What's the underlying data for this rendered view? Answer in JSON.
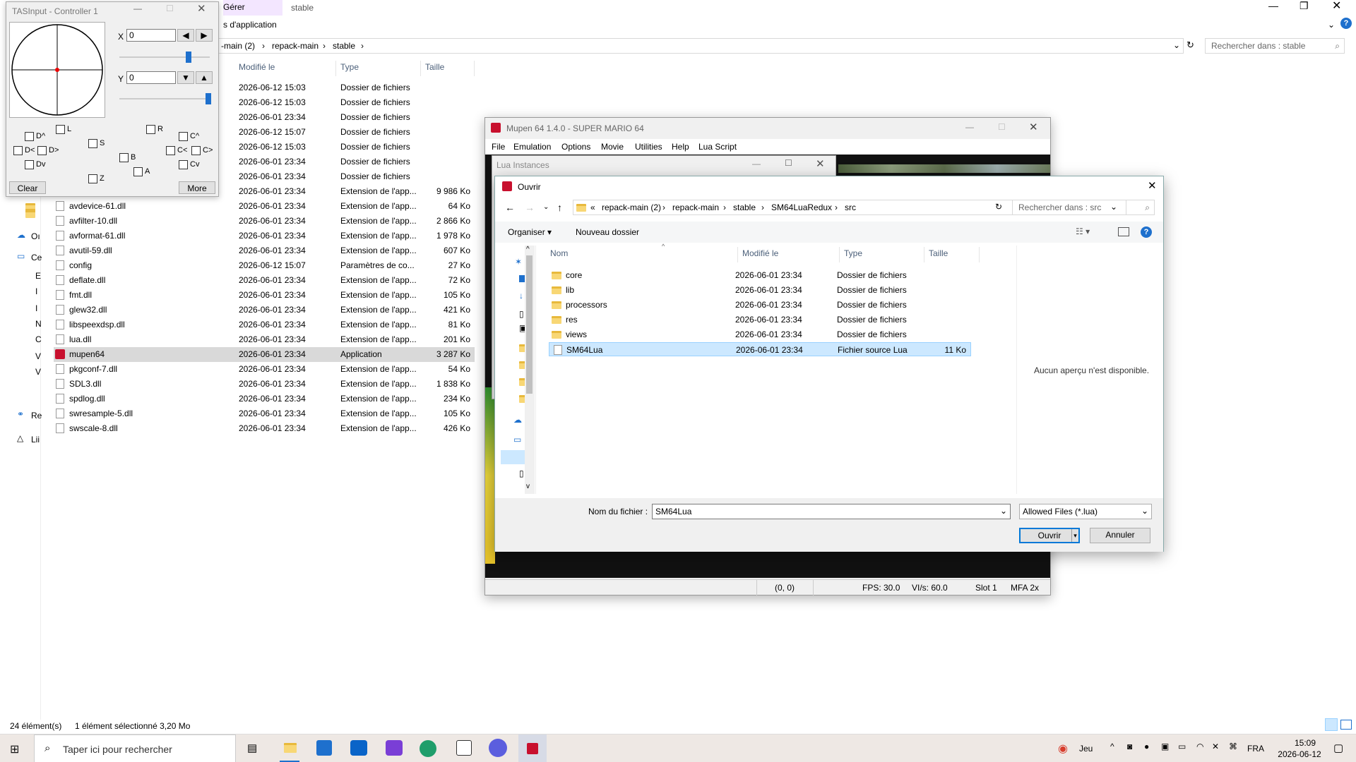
{
  "explorer": {
    "ribbon_tab": "Gérer",
    "ribbon_subtab": "s d'application",
    "window_title": "stable",
    "breadcrumb": [
      "-main (2)",
      "repack-main",
      "stable"
    ],
    "search_placeholder": "Rechercher dans : stable",
    "columns": {
      "modified": "Modifié le",
      "type": "Type",
      "size": "Taille"
    },
    "folder_rows": [
      {
        "date": "2026-06-12 15:03",
        "type": "Dossier de fichiers"
      },
      {
        "date": "2026-06-12 15:03",
        "type": "Dossier de fichiers"
      },
      {
        "date": "2026-06-01 23:34",
        "type": "Dossier de fichiers"
      },
      {
        "date": "2026-06-12 15:07",
        "type": "Dossier de fichiers"
      },
      {
        "date": "2026-06-12 15:03",
        "type": "Dossier de fichiers"
      },
      {
        "date": "2026-06-01 23:34",
        "type": "Dossier de fichiers"
      },
      {
        "date": "2026-06-01 23:34",
        "type": "Dossier de fichiers"
      },
      {
        "date": "2026-06-01 23:34",
        "type": "Extension de l'app...",
        "size": "9 986 Ko"
      }
    ],
    "files": [
      {
        "name": "avdevice-61.dll",
        "date": "2026-06-01 23:34",
        "type": "Extension de l'app...",
        "size": "64 Ko"
      },
      {
        "name": "avfilter-10.dll",
        "date": "2026-06-01 23:34",
        "type": "Extension de l'app...",
        "size": "2 866 Ko"
      },
      {
        "name": "avformat-61.dll",
        "date": "2026-06-01 23:34",
        "type": "Extension de l'app...",
        "size": "1 978 Ko"
      },
      {
        "name": "avutil-59.dll",
        "date": "2026-06-01 23:34",
        "type": "Extension de l'app...",
        "size": "607 Ko"
      },
      {
        "name": "config",
        "date": "2026-06-12 15:07",
        "type": "Paramètres de co...",
        "size": "27 Ko"
      },
      {
        "name": "deflate.dll",
        "date": "2026-06-01 23:34",
        "type": "Extension de l'app...",
        "size": "72 Ko"
      },
      {
        "name": "fmt.dll",
        "date": "2026-06-01 23:34",
        "type": "Extension de l'app...",
        "size": "105 Ko"
      },
      {
        "name": "glew32.dll",
        "date": "2026-06-01 23:34",
        "type": "Extension de l'app...",
        "size": "421 Ko"
      },
      {
        "name": "libspeexdsp.dll",
        "date": "2026-06-01 23:34",
        "type": "Extension de l'app...",
        "size": "81 Ko"
      },
      {
        "name": "lua.dll",
        "date": "2026-06-01 23:34",
        "type": "Extension de l'app...",
        "size": "201 Ko"
      },
      {
        "name": "mupen64",
        "date": "2026-06-01 23:34",
        "type": "Application",
        "size": "3 287 Ko"
      },
      {
        "name": "pkgconf-7.dll",
        "date": "2026-06-01 23:34",
        "type": "Extension de l'app...",
        "size": "54 Ko"
      },
      {
        "name": "SDL3.dll",
        "date": "2026-06-01 23:34",
        "type": "Extension de l'app...",
        "size": "1 838 Ko"
      },
      {
        "name": "spdlog.dll",
        "date": "2026-06-01 23:34",
        "type": "Extension de l'app...",
        "size": "234 Ko"
      },
      {
        "name": "swresample-5.dll",
        "date": "2026-06-01 23:34",
        "type": "Extension de l'app...",
        "size": "105 Ko"
      },
      {
        "name": "swscale-8.dll",
        "date": "2026-06-01 23:34",
        "type": "Extension de l'app...",
        "size": "426 Ko"
      }
    ],
    "nav_items": [
      "Oı",
      "Ce",
      "E",
      "I",
      "I",
      "N",
      "C",
      "V",
      "V",
      "Re",
      "Lii"
    ],
    "status_count": "24 élément(s)",
    "status_selected": "1 élément sélectionné 3,20 Mo"
  },
  "tasinput": {
    "title": "TASInput - Controller 1",
    "x_label": "X",
    "x_value": "0",
    "y_label": "Y",
    "y_value": "0",
    "buttons": [
      "L",
      "R",
      "S",
      "B",
      "A",
      "Z",
      "D^",
      "D<",
      "D>",
      "Dv",
      "C^",
      "C<",
      "C>",
      "Cv"
    ],
    "clear": "Clear",
    "more": "More"
  },
  "mupen": {
    "title": "Mupen 64 1.4.0 - SUPER MARIO 64",
    "menu": [
      "File",
      "Emulation",
      "Options",
      "Movie",
      "Utilities",
      "Help",
      "Lua Script"
    ],
    "status": [
      "(0, 0)",
      "FPS: 30.0",
      "VI/s: 60.0",
      "Slot 1",
      "MFA 2x"
    ]
  },
  "lua_instances": {
    "title": "Lua Instances"
  },
  "dialog": {
    "title": "Ouvrir",
    "path": [
      "«",
      "repack-main (2)",
      "repack-main",
      "stable",
      "SM64LuaRedux",
      "src"
    ],
    "search_placeholder": "Rechercher dans : src",
    "organize": "Organiser",
    "new_folder": "Nouveau dossier",
    "columns": {
      "name": "Nom",
      "modified": "Modifié le",
      "type": "Type",
      "size": "Taille"
    },
    "rows": [
      {
        "name": "core",
        "date": "2026-06-01 23:34",
        "type": "Dossier de fichiers",
        "size": ""
      },
      {
        "name": "lib",
        "date": "2026-06-01 23:34",
        "type": "Dossier de fichiers",
        "size": ""
      },
      {
        "name": "processors",
        "date": "2026-06-01 23:34",
        "type": "Dossier de fichiers",
        "size": ""
      },
      {
        "name": "res",
        "date": "2026-06-01 23:34",
        "type": "Dossier de fichiers",
        "size": ""
      },
      {
        "name": "views",
        "date": "2026-06-01 23:34",
        "type": "Dossier de fichiers",
        "size": ""
      },
      {
        "name": "SM64Lua",
        "date": "2026-06-01 23:34",
        "type": "Fichier source Lua",
        "size": "11 Ko"
      }
    ],
    "preview_text": "Aucun aperçu n'est disponible.",
    "filename_label": "Nom du fichier :",
    "filename_value": "SM64Lua",
    "filter": "Allowed Files (*.lua)",
    "open": "Ouvrir",
    "cancel": "Annuler"
  },
  "taskbar": {
    "search_placeholder": "Taper ici pour rechercher",
    "weather": "Jeu",
    "lang": "FRA",
    "time": "15:09",
    "date": "2026-06-12"
  }
}
